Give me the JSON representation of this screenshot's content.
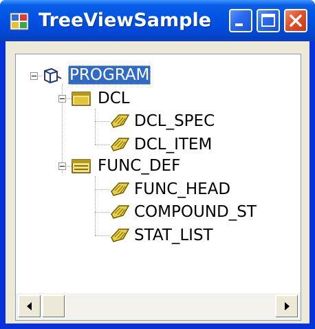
{
  "window": {
    "title": "TreeViewSample"
  },
  "titlebar_buttons": {
    "minimize_icon": "minimize-icon",
    "maximize_icon": "maximize-icon",
    "close_icon": "close-icon"
  },
  "tree": {
    "nodes": [
      {
        "label": "PROGRAM",
        "icon": "program-icon",
        "expanded": true,
        "selected": true
      },
      {
        "label": "DCL",
        "icon": "folder-icon",
        "expanded": true,
        "selected": false
      },
      {
        "label": "DCL_SPEC",
        "icon": "leaf-icon",
        "selected": false
      },
      {
        "label": "DCL_ITEM",
        "icon": "leaf-icon",
        "selected": false
      },
      {
        "label": "FUNC_DEF",
        "icon": "folder-icon",
        "expanded": true,
        "selected": false
      },
      {
        "label": "FUNC_HEAD",
        "icon": "leaf-icon",
        "selected": false
      },
      {
        "label": "COMPOUND_ST",
        "icon": "leaf-icon",
        "selected": false
      },
      {
        "label": "STAT_LIST",
        "icon": "leaf-icon",
        "selected": false
      }
    ]
  },
  "scrollbar": {
    "orientation": "horizontal",
    "left_arrow_icon": "arrow-left-icon",
    "right_arrow_icon": "arrow-right-icon"
  },
  "colors": {
    "titlebar": "#0054e3",
    "selection": "#316ac5",
    "client": "#ece9d8"
  }
}
